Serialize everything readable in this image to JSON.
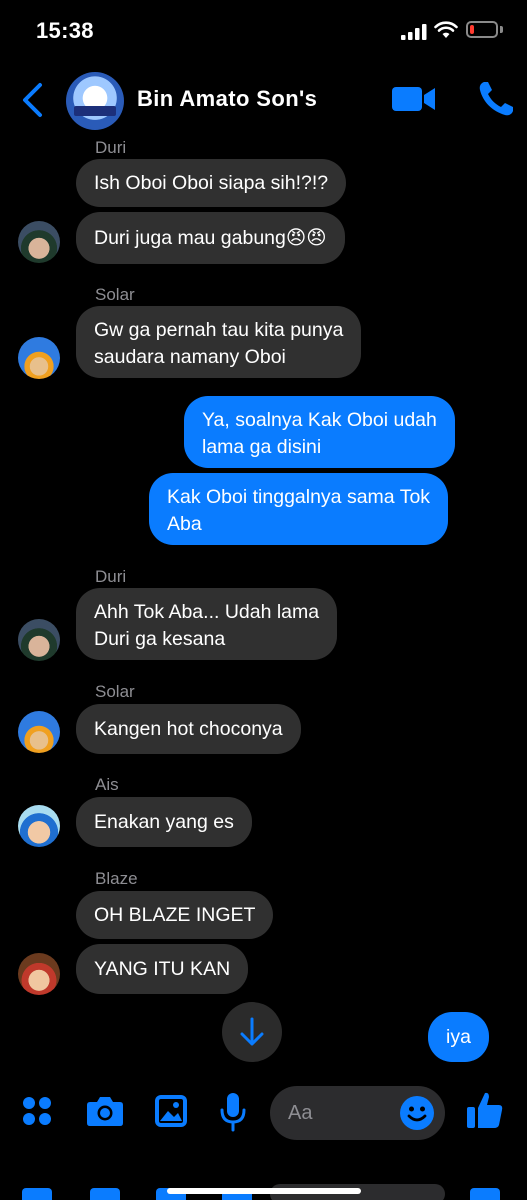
{
  "status_bar": {
    "time": "15:38",
    "battery_level": 0.15,
    "battery_color": "#ff3b30",
    "icons": [
      "cellular-signal-icon",
      "wifi-icon",
      "battery-icon"
    ]
  },
  "header": {
    "title": "Bin Amato Son's",
    "icons": [
      "back-chevron-icon",
      "group-avatar",
      "video-call-icon",
      "phone-call-icon"
    ]
  },
  "colors": {
    "accent": "#0a7cff",
    "incoming_bubble": "#303030",
    "background": "#000000",
    "sender_label": "#8e8e93"
  },
  "messages": [
    {
      "sender": "Duri",
      "direction": "in",
      "lines": [
        "Ish Oboi Oboi siapa sih!?!?"
      ]
    },
    {
      "sender": "Duri",
      "direction": "in",
      "lines": [
        "Duri juga mau gabung😠😠"
      ]
    },
    {
      "sender": "Solar",
      "direction": "in",
      "lines": [
        "Gw ga pernah tau kita punya",
        "saudara namany Oboi"
      ]
    },
    {
      "sender": "",
      "direction": "out",
      "lines": [
        "Ya, soalnya Kak Oboi udah",
        "lama ga disini"
      ]
    },
    {
      "sender": "",
      "direction": "out",
      "lines": [
        "Kak Oboi tinggalnya sama Tok",
        "Aba"
      ]
    },
    {
      "sender": "Duri",
      "direction": "in",
      "lines": [
        "Ahh Tok Aba... Udah lama",
        "Duri ga kesana"
      ]
    },
    {
      "sender": "Solar",
      "direction": "in",
      "lines": [
        "Kangen hot choconya"
      ]
    },
    {
      "sender": "Ais",
      "direction": "in",
      "lines": [
        "Enakan yang es"
      ]
    },
    {
      "sender": "Blaze",
      "direction": "in",
      "lines": [
        "OH BLAZE INGET"
      ]
    },
    {
      "sender": "Blaze",
      "direction": "in",
      "lines": [
        "YANG ITU KAN"
      ]
    },
    {
      "sender": "",
      "direction": "out",
      "lines": [
        "iya"
      ]
    }
  ],
  "sender_labels": [
    "Duri",
    "Solar",
    "Duri",
    "Solar",
    "Ais",
    "Blaze"
  ],
  "composer": {
    "placeholder": "Aa",
    "icons": [
      "more-apps-icon",
      "camera-icon",
      "gallery-icon",
      "microphone-icon",
      "emoji-icon",
      "thumbs-up-icon"
    ]
  },
  "scroll_down_icon": "arrow-down-icon"
}
